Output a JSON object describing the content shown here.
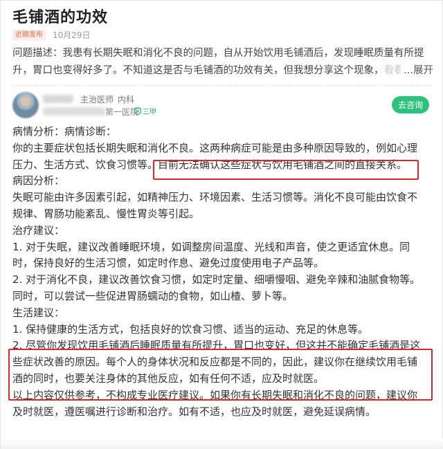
{
  "article": {
    "title": "毛铺酒的功效",
    "tag": "近期发布",
    "date": "10月29日"
  },
  "question": {
    "line1": "问题描述：我患有长期失眠和消化不良的问题，自从开始饮用毛铺酒后，发现睡眠质量有所提",
    "line2": "升，胃口也变得好多了。不知道这是否与毛铺酒的功效有关，但我想分享这个现象，",
    "line2_faded": "看看",
    "expand_label": "...展开"
  },
  "doctor": {
    "title": "主治医师",
    "department": "内科",
    "hospital": "第一医院",
    "grade": "三甲",
    "consult_label": "去咨询"
  },
  "answer": {
    "lines": [
      "病情分析：病情诊断：",
      "你的主要症状包括长期失眠和消化不良。这两种病症可能是由多种原因导致的，例如心理",
      "压力、生活方式、饮食习惯等。目前无法确认这些症状与饮用毛铺酒之间的直接关系。",
      "病因分析：",
      "失眠可能由许多因素引起，如精神压力、环境因素、生活习惯等。消化不良可能由饮食不",
      "规律、胃肠功能紊乱、慢性胃炎等引起。",
      "治疗建议：",
      "1. 对于失眠，建议改善睡眠环境，如调整房间温度、光线和声音，使之更适宜休息。同",
      "时，保持良好的生活习惯，如定时作息、避免过度使用电子产品等。",
      "2. 对于消化不良，建议改善饮食习惯，如定时定量、细嚼慢咽、避免辛辣和油腻食物等。",
      "同时，可以尝试一些促进胃肠蠕动的食物，如山楂、萝卜等。",
      "生活建议：",
      "1. 保持健康的生活方式，包括良好的饮食习惯、适当的运动、充足的休息等。",
      "2. 尽管你发现饮用毛铺酒后睡眠质量有所提升，胃口也变好，但这并不能确定毛铺酒是这",
      "些症状改善的原因。每个人的身体状况和反应都是不同的，因此，建议你在继续饮用毛铺",
      "酒的同时，也要关注身体的其他反应，如有任何不适，应及时就医。",
      "以上内容仅供参考，不构成专业医疗建议。如果你有长期失眠和消化不良的问题，建议你",
      "及时就医，遵医嘱进行诊断和治疗。如有不适，也应及时就医，避免延误病情。"
    ]
  },
  "colors": {
    "highlight_box": "#d9272e",
    "consult_button": "#2fc27f",
    "tag": "#e06a4a"
  },
  "icons": [
    "shield-icon"
  ]
}
